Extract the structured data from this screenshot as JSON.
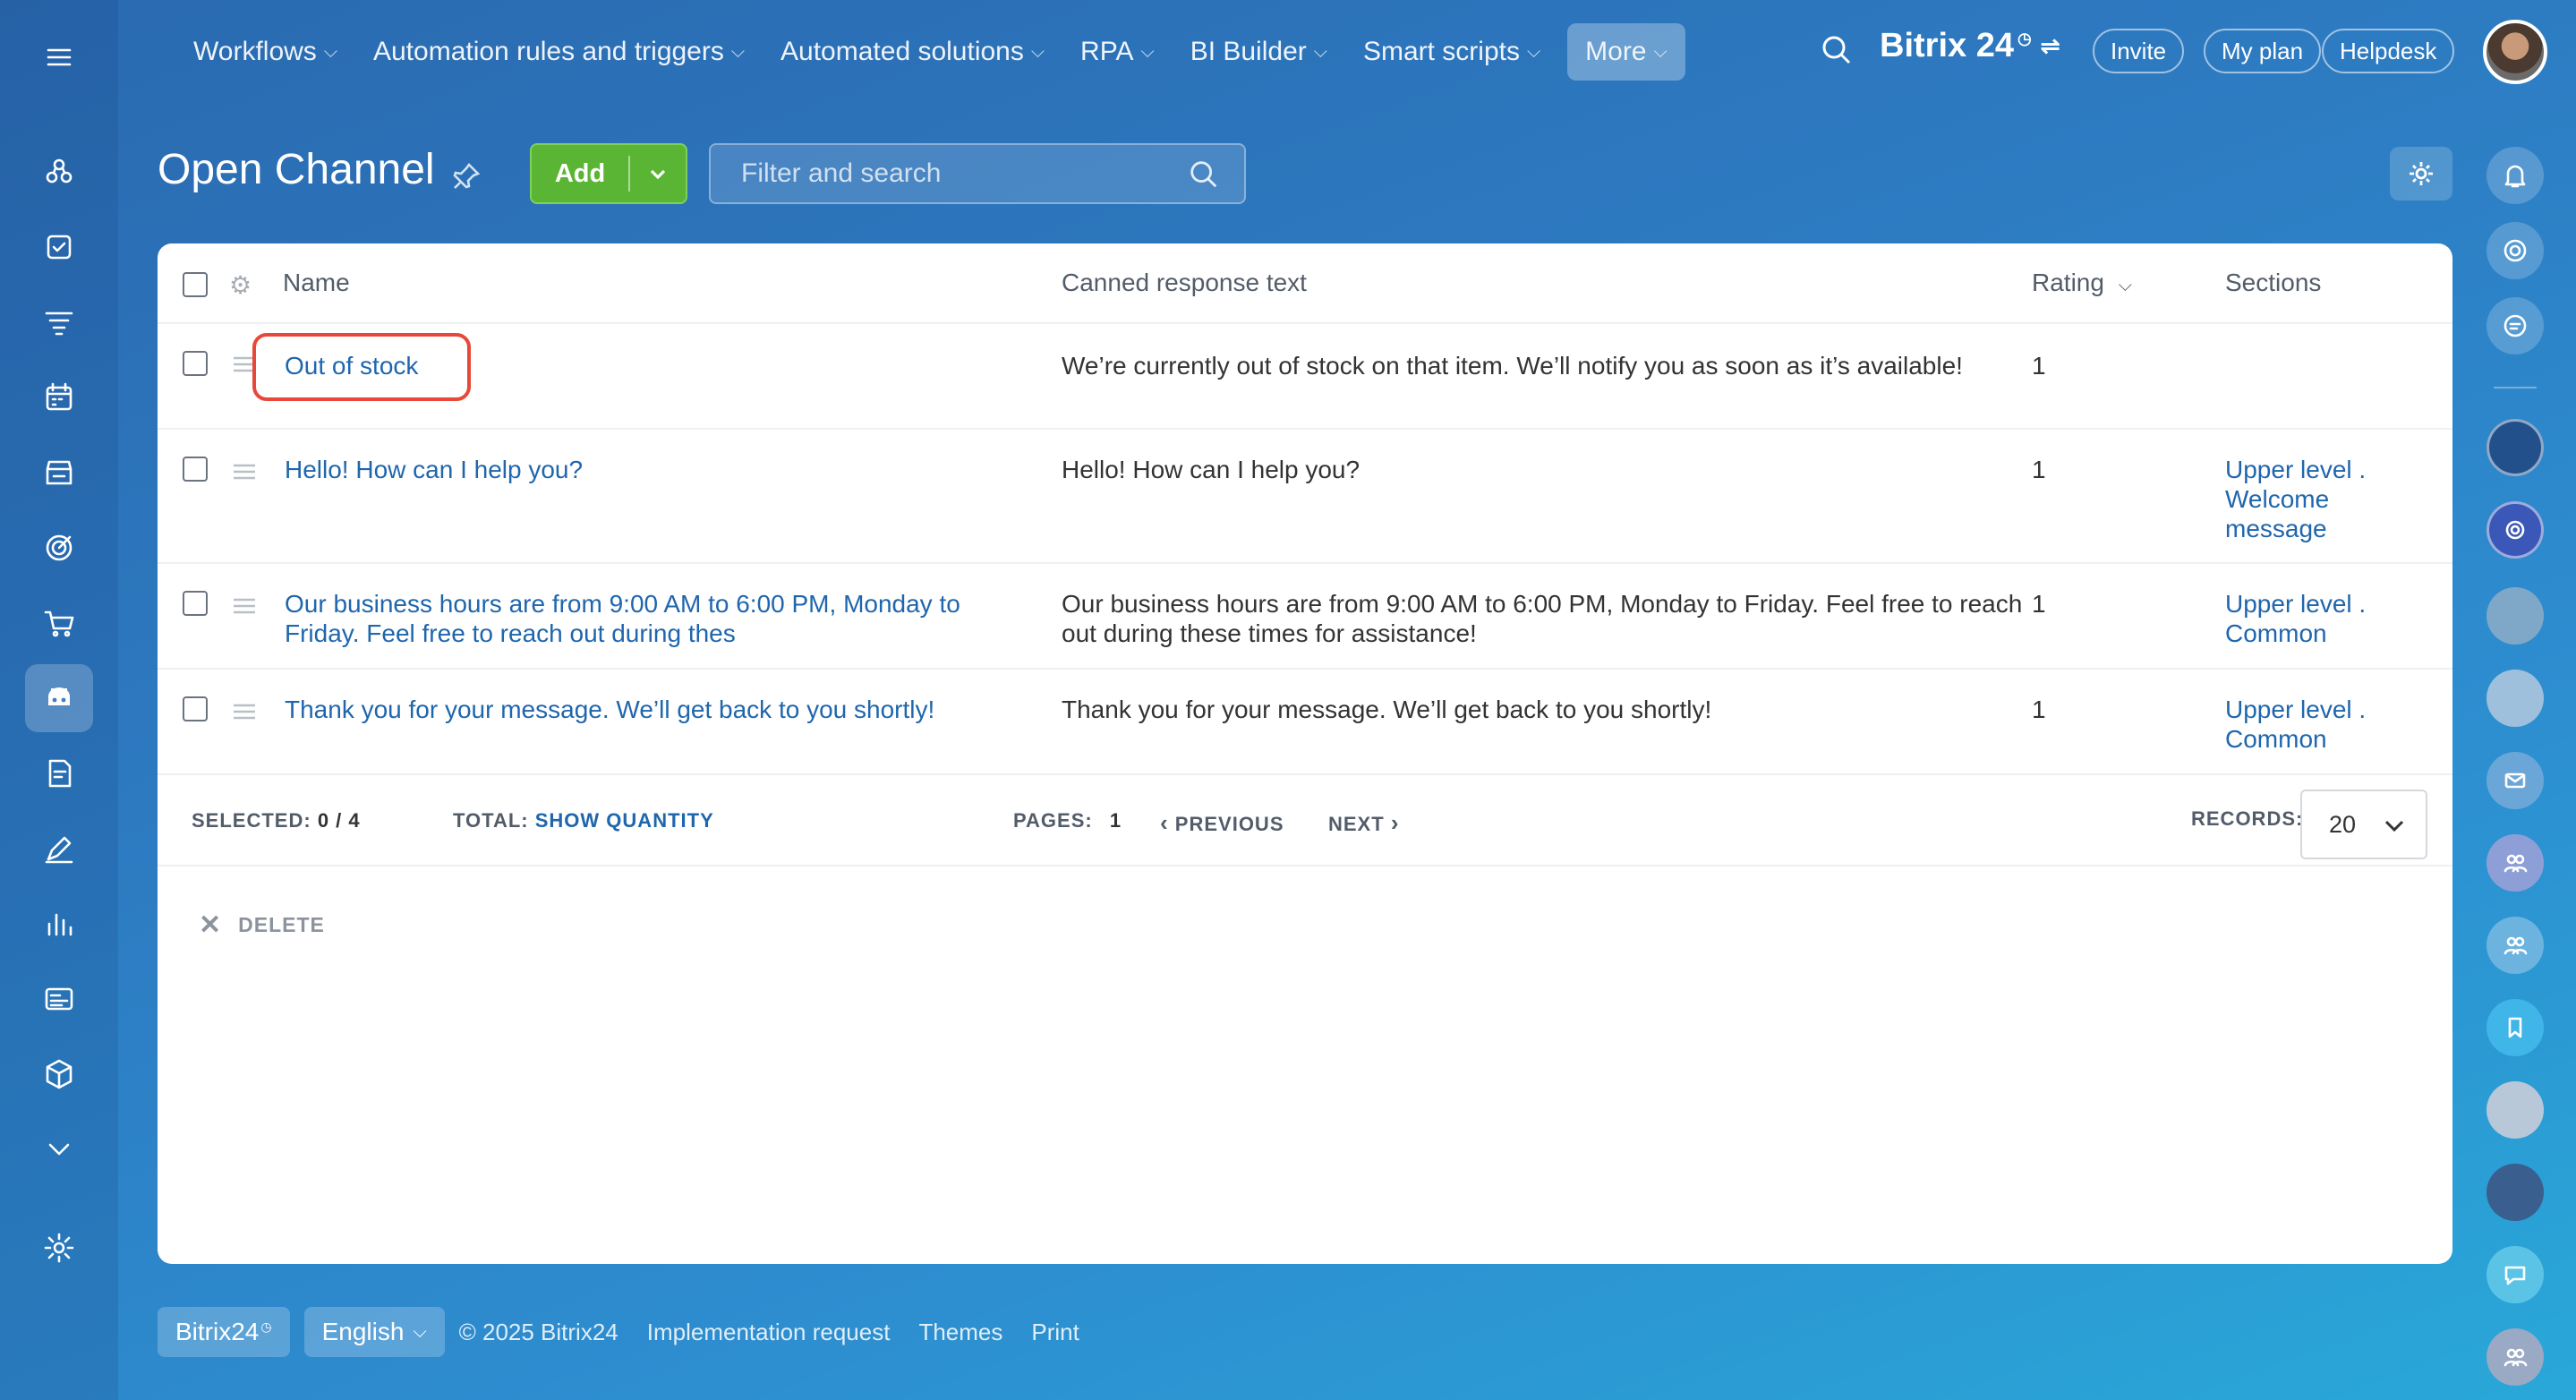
{
  "topnav": {
    "items": [
      {
        "label": "Workflows"
      },
      {
        "label": "Automation rules and triggers"
      },
      {
        "label": "Automated solutions"
      },
      {
        "label": "RPA"
      },
      {
        "label": "BI Builder"
      },
      {
        "label": "Smart scripts"
      },
      {
        "label": "More"
      }
    ],
    "brand": "Bitrix 24",
    "invite": "Invite",
    "my_plan": "My plan",
    "helpdesk": "Helpdesk"
  },
  "page": {
    "title": "Open Channel",
    "add_label": "Add",
    "search_placeholder": "Filter and search"
  },
  "grid": {
    "columns": {
      "name": "Name",
      "text": "Canned response text",
      "rating": "Rating",
      "sections": "Sections"
    },
    "rows": [
      {
        "name": "Out of stock",
        "text": "We’re currently out of stock on that item. We’ll notify you as soon as it’s available!",
        "rating": "1",
        "section": ""
      },
      {
        "name": "Hello! How can I help you?",
        "text": "Hello! How can I help you?",
        "rating": "1",
        "section": "Upper level . Welcome message"
      },
      {
        "name": "Our business hours are from 9:00 AM to 6:00 PM, Monday to Friday. Feel free to reach out during thes",
        "text": "Our business hours are from 9:00 AM to 6:00 PM, Monday to Friday. Feel free to reach out during these times for assistance!",
        "rating": "1",
        "section": "Upper level . Common"
      },
      {
        "name": "Thank you for your message. We’ll get back to you shortly!",
        "text": "Thank you for your message. We’ll get back to you shortly!",
        "rating": "1",
        "section": "Upper level . Common"
      }
    ]
  },
  "footer_bar": {
    "selected_label": "SELECTED:",
    "selected_value": "0 / 4",
    "total_label": "TOTAL:",
    "total_link": "SHOW QUANTITY",
    "pages_label": "PAGES:",
    "pages_value": "1",
    "previous": "PREVIOUS",
    "next": "NEXT",
    "records_label": "RECORDS:",
    "records_value": "20",
    "delete": "DELETE"
  },
  "bottom": {
    "brand_chip": "Bitrix24",
    "language": "English",
    "copyright": "© 2025 Bitrix24",
    "implementation": "Implementation request",
    "themes": "Themes",
    "print": "Print"
  }
}
